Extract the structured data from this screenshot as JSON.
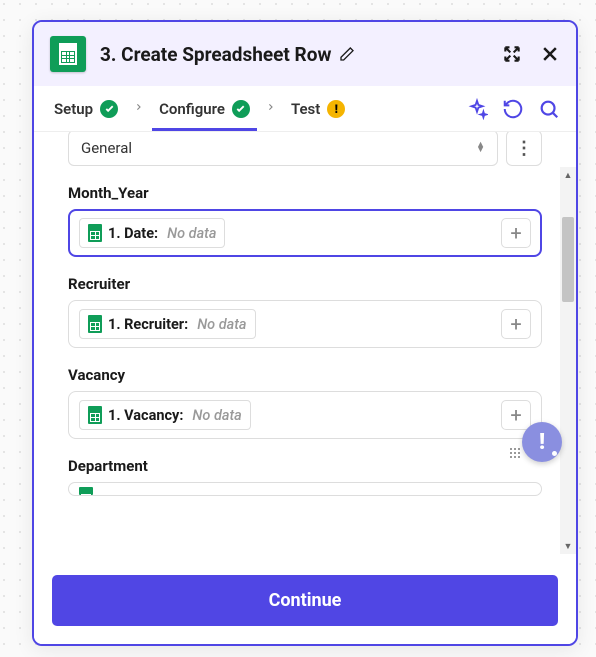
{
  "header": {
    "title": "3. Create Spreadsheet Row"
  },
  "tabs": {
    "setup": "Setup",
    "configure": "Configure",
    "test": "Test"
  },
  "worksheet": {
    "value": "General"
  },
  "fields": [
    {
      "label": "Month_Year",
      "pill_main": "1. Date:",
      "pill_nodata": "No data",
      "focused": true
    },
    {
      "label": "Recruiter",
      "pill_main": "1. Recruiter:",
      "pill_nodata": "No data",
      "focused": false
    },
    {
      "label": "Vacancy",
      "pill_main": "1. Vacancy:",
      "pill_nodata": "No data",
      "focused": false
    },
    {
      "label": "Department",
      "pill_main": "",
      "pill_nodata": "",
      "focused": false
    }
  ],
  "footer": {
    "continue": "Continue"
  }
}
